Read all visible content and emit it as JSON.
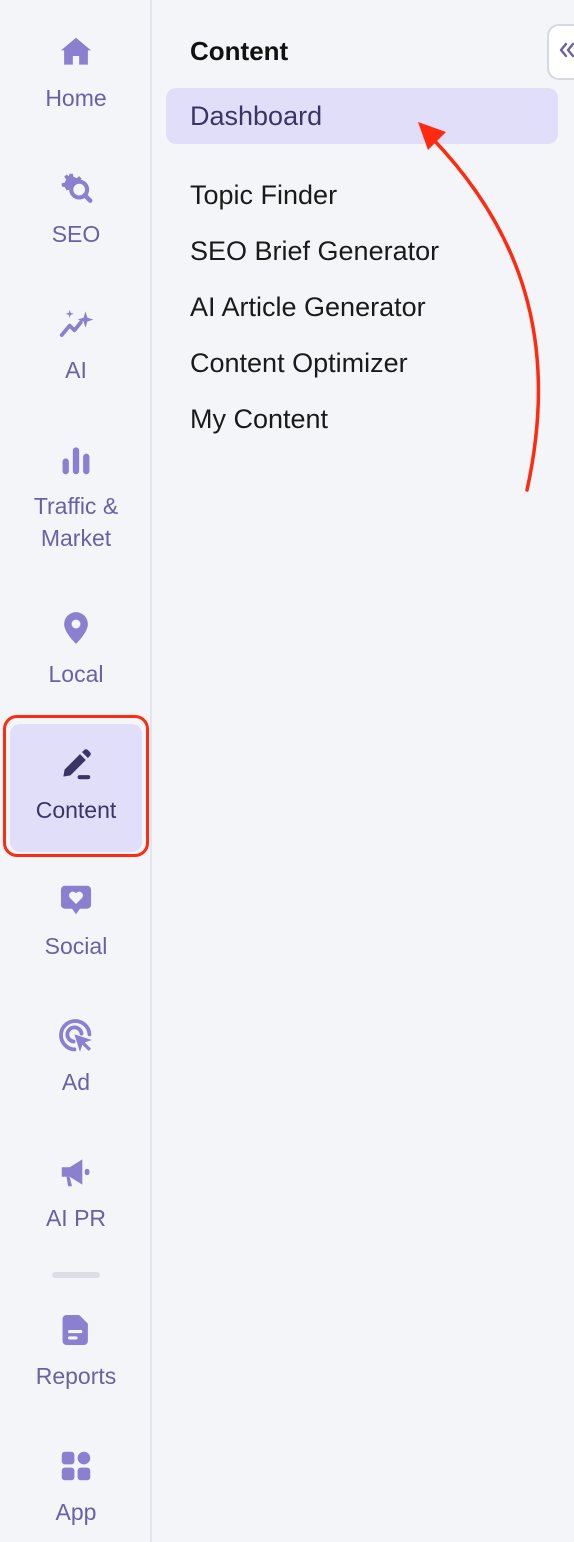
{
  "rail": {
    "items": [
      {
        "label": "Home",
        "icon": "home-icon"
      },
      {
        "label": "SEO",
        "icon": "seo-gear-search-icon"
      },
      {
        "label": "AI",
        "icon": "ai-sparkle-icon"
      },
      {
        "label": "Traffic & Market",
        "icon": "bar-chart-icon"
      },
      {
        "label": "Local",
        "icon": "location-pin-icon"
      },
      {
        "label": "Content",
        "icon": "pencil-icon"
      },
      {
        "label": "Social",
        "icon": "heart-chat-icon"
      },
      {
        "label": "Ad",
        "icon": "target-cursor-icon"
      },
      {
        "label": "AI PR",
        "icon": "megaphone-icon"
      },
      {
        "label": "Reports",
        "icon": "document-icon"
      },
      {
        "label": "App",
        "icon": "apps-grid-icon"
      }
    ],
    "active": "Content"
  },
  "submenu": {
    "title": "Content",
    "items": [
      {
        "label": "Dashboard"
      },
      {
        "label": "Topic Finder"
      },
      {
        "label": "SEO Brief Generator"
      },
      {
        "label": "AI Article Generator"
      },
      {
        "label": "Content Optimizer"
      },
      {
        "label": "My Content"
      }
    ],
    "active": "Dashboard"
  },
  "colors": {
    "accent": "#6b5fa6",
    "active_bg": "#e1defa",
    "annotation": "#ff2a10",
    "background": "#f4f5f9"
  }
}
